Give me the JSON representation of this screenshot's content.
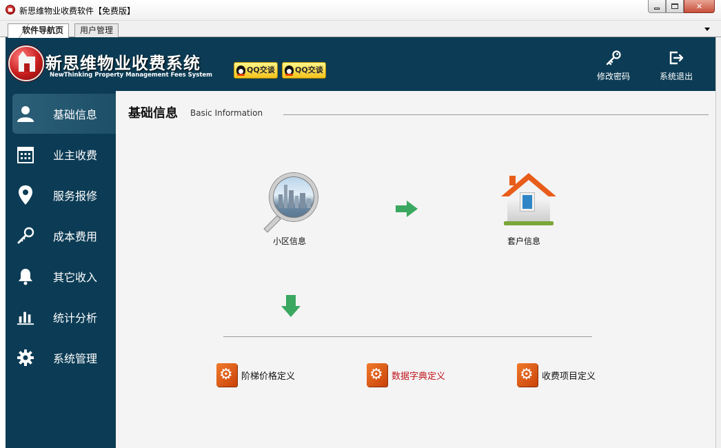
{
  "window": {
    "title": "新思维物业收费软件【免费版】"
  },
  "tabs": [
    {
      "label": "软件导航页",
      "active": true
    },
    {
      "label": "用户管理",
      "active": false
    }
  ],
  "header": {
    "brand_cn": "新思维物业收费系统",
    "brand_en": "NewThinking  Property Management Fees System",
    "qq_buttons": [
      "QQ交谈",
      "QQ交谈"
    ],
    "actions": [
      {
        "label": "修改密码",
        "icon": "key-icon"
      },
      {
        "label": "系统退出",
        "icon": "logout-icon"
      }
    ]
  },
  "sidebar": {
    "items": [
      {
        "label": "基础信息",
        "icon": "user-icon",
        "active": true
      },
      {
        "label": "业主收费",
        "icon": "calendar-icon",
        "active": false
      },
      {
        "label": "服务报修",
        "icon": "map-pin-icon",
        "active": false
      },
      {
        "label": "成本费用",
        "icon": "tool-icon",
        "active": false
      },
      {
        "label": "其它收入",
        "icon": "bell-icon",
        "active": false
      },
      {
        "label": "统计分析",
        "icon": "bar-chart-icon",
        "active": false
      },
      {
        "label": "系统管理",
        "icon": "gear-icon",
        "active": false
      }
    ]
  },
  "content": {
    "title": "基础信息",
    "subtitle": "Basic Information",
    "modules": [
      {
        "label": "小区信息",
        "icon": "magnifier-city-icon"
      },
      {
        "label": "套户信息",
        "icon": "house-icon"
      }
    ],
    "links": [
      {
        "label": "阶梯价格定义",
        "icon": "gear-tile-icon"
      },
      {
        "label": "数据字典定义",
        "icon": "gear-tile-icon",
        "highlighted": true
      },
      {
        "label": "收费项目定义",
        "icon": "gear-tile-icon"
      }
    ]
  },
  "colors": {
    "header_bg": "#0c3c55",
    "content_bg": "#f4f4f4",
    "arrow_green": "#3aa860",
    "accent_orange": "#e85d1a",
    "link_highlight": "#c0141c"
  }
}
